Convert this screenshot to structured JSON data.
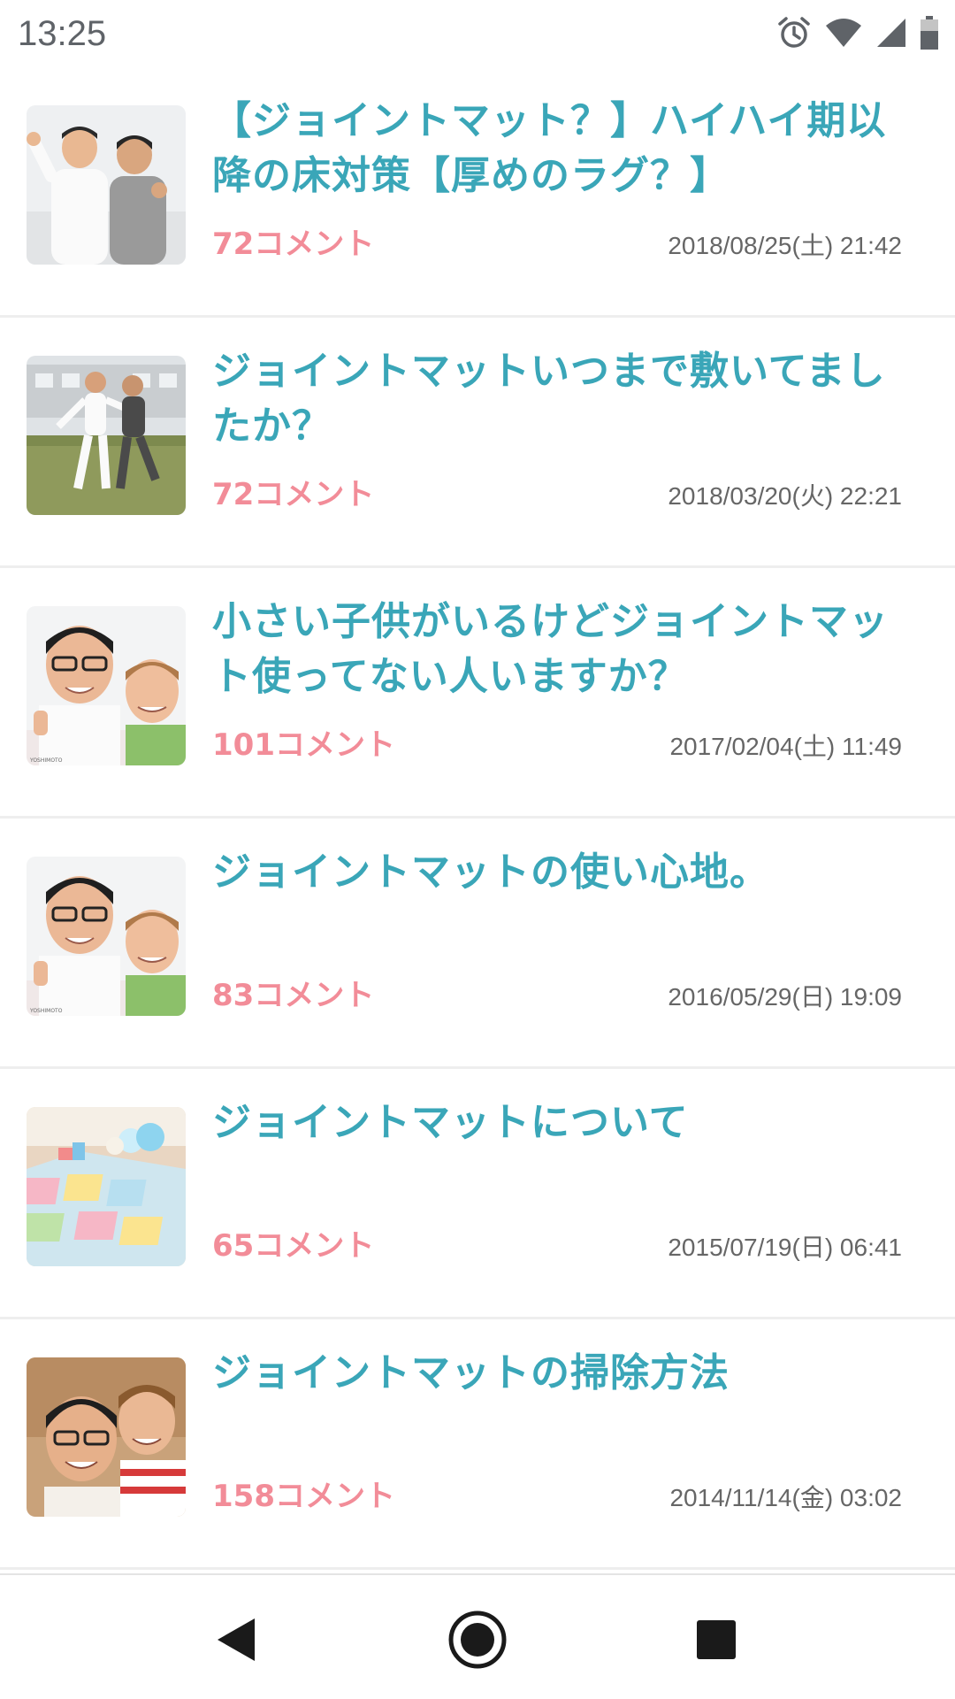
{
  "status_bar": {
    "time": "13:25",
    "icons": [
      "alarm-icon",
      "wifi-icon",
      "signal-icon",
      "battery-icon"
    ],
    "icon_color": "#5f6368"
  },
  "colors": {
    "title": "#3aa6b8",
    "comments": "#f28c98",
    "date": "#666666",
    "divider": "#eeeeee"
  },
  "topics": [
    {
      "title": "【ジョイントマット？】ハイハイ期以降の床対策【厚めのラグ？】",
      "comment_count": "72",
      "comment_suffix": "コメント",
      "date": "2018/08/25(土) 21:42",
      "thumbnail": "two-men-posing-photo"
    },
    {
      "title": "ジョイントマットいつまで敷いてましたか？",
      "comment_count": "72",
      "comment_suffix": "コメント",
      "date": "2018/03/20(火) 22:21",
      "thumbnail": "two-men-jumping-on-grass-photo"
    },
    {
      "title": "小さい子供がいるけどジョイントマット使ってない人いますか？",
      "comment_count": "101",
      "comment_suffix": "コメント",
      "date": "2017/02/04(土) 11:49",
      "thumbnail": "two-men-thumbs-up-photo"
    },
    {
      "title": "ジョイントマットの使い心地。",
      "comment_count": "83",
      "comment_suffix": "コメント",
      "date": "2016/05/29(日) 19:09",
      "thumbnail": "two-men-thumbs-up-photo"
    },
    {
      "title": "ジョイントマットについて",
      "comment_count": "65",
      "comment_suffix": "コメント",
      "date": "2015/07/19(日) 06:41",
      "thumbnail": "joint-mat-with-toys-photo"
    },
    {
      "title": "ジョイントマットの掃除方法",
      "comment_count": "158",
      "comment_suffix": "コメント",
      "date": "2014/11/14(金) 03:02",
      "thumbnail": "two-men-closeup-photo"
    }
  ],
  "nav_bar": {
    "buttons": [
      "back-icon",
      "home-icon",
      "recents-icon"
    ]
  }
}
